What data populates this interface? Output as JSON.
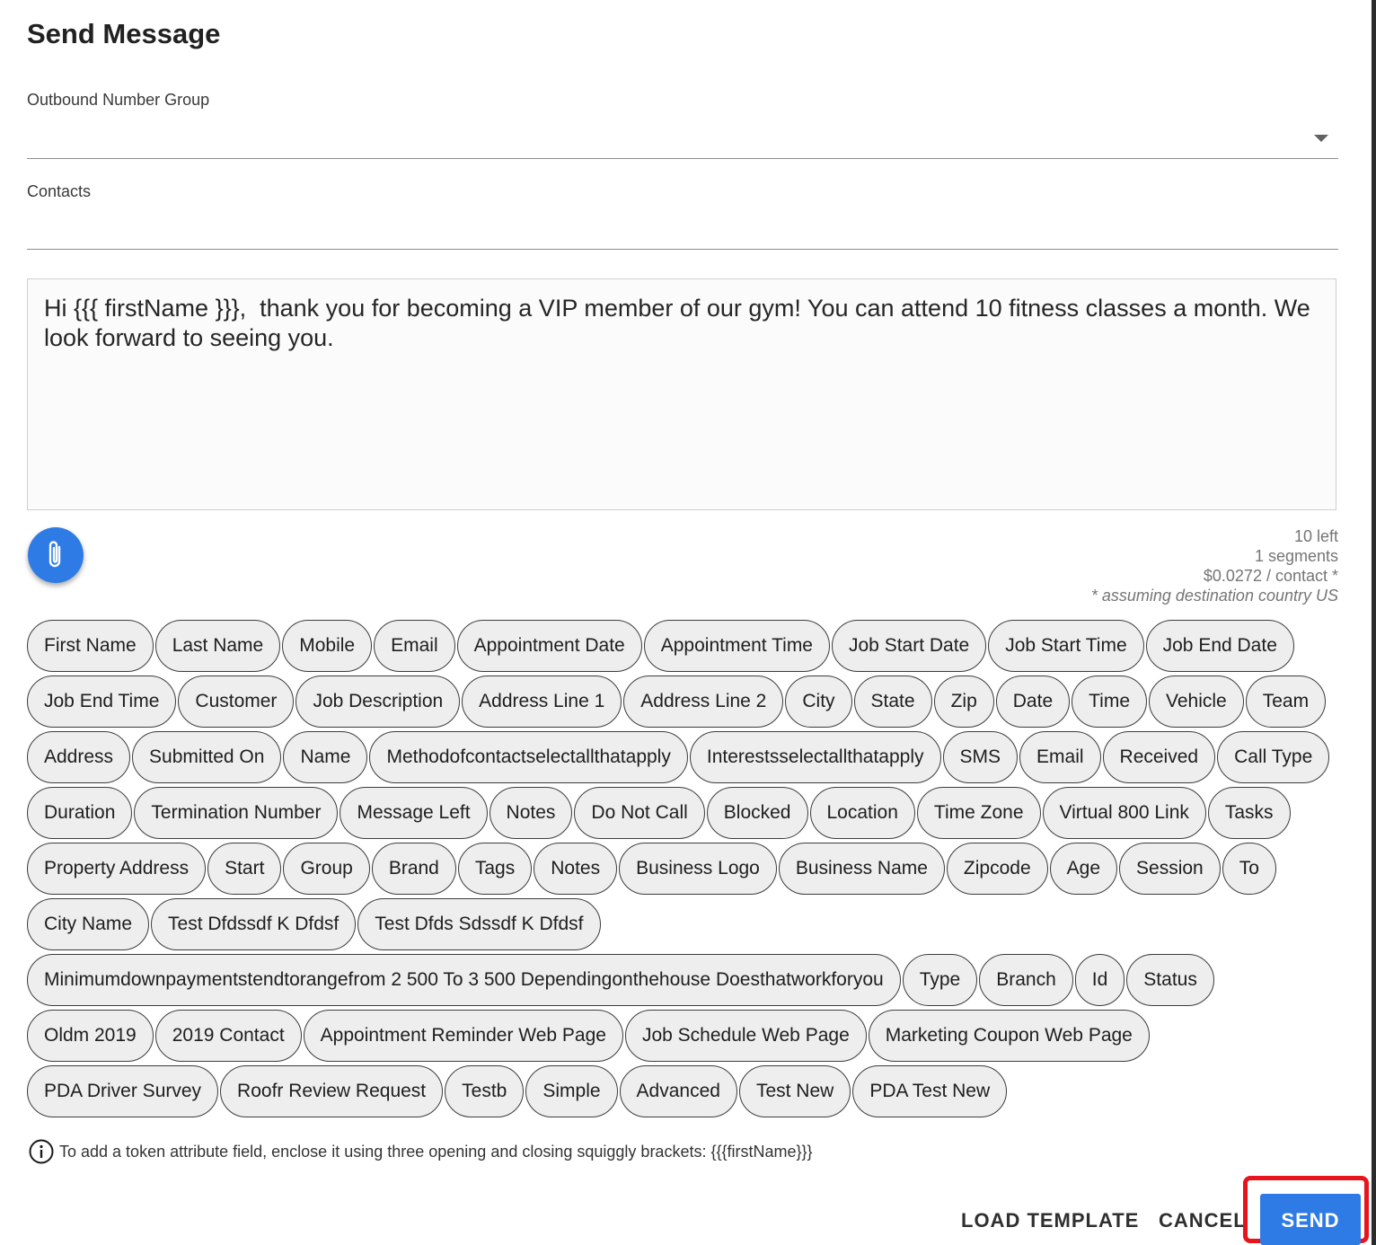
{
  "dialog": {
    "title": "Send Message"
  },
  "outbound": {
    "label": "Outbound Number Group",
    "value": ""
  },
  "contacts": {
    "label": "Contacts",
    "value": ""
  },
  "message": {
    "text": "Hi {{{ firstName }}},  thank you for becoming a VIP member of our gym! You can attend 10 fitness classes a month. We look forward to seeing you."
  },
  "attach": {
    "icon": "paperclip-icon"
  },
  "stats": {
    "remaining": "10 left",
    "segments": "1 segments",
    "cost": "$0.0272 / contact *",
    "note": "* assuming destination country US"
  },
  "token_rows": [
    [
      "First Name",
      "Last Name",
      "Mobile",
      "Email",
      "Appointment Date",
      "Appointment Time",
      "Job Start Date",
      "Job Start Time",
      "Job End Date"
    ],
    [
      "Job End Time",
      "Customer",
      "Job Description",
      "Address Line 1",
      "Address Line 2",
      "City",
      "State",
      "Zip",
      "Date",
      "Time",
      "Vehicle",
      "Team"
    ],
    [
      "Address",
      "Submitted On",
      "Name",
      "Methodofcontactselectallthatapply",
      "Interestsselectallthatapply",
      "SMS",
      "Email",
      "Received",
      "Call Type"
    ],
    [
      "Duration",
      "Termination Number",
      "Message Left",
      "Notes",
      "Do Not Call",
      "Blocked",
      "Location",
      "Time Zone",
      "Virtual 800 Link",
      "Tasks"
    ],
    [
      "Property Address",
      "Start",
      "Group",
      "Brand",
      "Tags",
      "Notes",
      "Business Logo",
      "Business Name",
      "Zipcode",
      "Age",
      "Session",
      "To"
    ],
    [
      "City Name",
      "Test Dfdssdf K Dfdsf",
      "Test Dfds Sdssdf K Dfdsf"
    ],
    [
      "Minimumdownpaymentstendtorangefrom 2 500 To 3 500 Dependingonthehouse Doesthatworkforyou",
      "Type",
      "Branch",
      "Id",
      "Status"
    ],
    [
      "Oldm 2019",
      "2019 Contact",
      "Appointment Reminder Web Page",
      "Job Schedule Web Page",
      "Marketing Coupon Web Page"
    ],
    [
      "PDA Driver Survey",
      "Roofr Review Request",
      "Testb",
      "Simple",
      "Advanced",
      "Test New",
      "PDA Test New"
    ]
  ],
  "hint": {
    "icon": "info-icon",
    "text": "To add a token attribute field, enclose it using three opening and closing squiggly brackets: {{{firstName}}}"
  },
  "footer": {
    "load_template": "LOAD TEMPLATE",
    "cancel": "CANCEL",
    "send": "SEND"
  },
  "colors": {
    "accent": "#2f7be5",
    "highlight": "#e8141b",
    "chip_bg": "#eeeeee"
  }
}
